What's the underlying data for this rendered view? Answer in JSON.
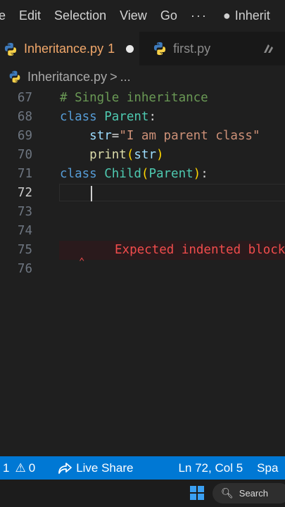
{
  "menubar": {
    "items": [
      "e",
      "Edit",
      "Selection",
      "View",
      "Go",
      "···"
    ],
    "title": "Inherit"
  },
  "tabs": [
    {
      "label": "Inheritance.py",
      "problems": "1",
      "modified": true,
      "active": true
    },
    {
      "label": "first.py",
      "active": false
    }
  ],
  "breadcrumb": {
    "file": "Inheritance.py",
    "sep": ">",
    "rest": "..."
  },
  "editor": {
    "lines": [
      {
        "no": "67",
        "tokens": [
          {
            "t": "# Single inheritance",
            "c": "tok-comment"
          }
        ]
      },
      {
        "no": "68",
        "tokens": [
          {
            "t": "class ",
            "c": "tok-kw"
          },
          {
            "t": "Parent",
            "c": "tok-cls"
          },
          {
            "t": ":",
            "c": "tok-punc"
          }
        ]
      },
      {
        "no": "69",
        "tokens": [
          {
            "t": "    ",
            "c": "tok-punc"
          },
          {
            "t": "str",
            "c": "tok-var"
          },
          {
            "t": "=",
            "c": "tok-punc"
          },
          {
            "t": "\"I am parent class\"",
            "c": "tok-str"
          }
        ]
      },
      {
        "no": "70",
        "tokens": [
          {
            "t": "    ",
            "c": "tok-punc"
          },
          {
            "t": "print",
            "c": "tok-fn"
          },
          {
            "t": "(",
            "c": "tok-paren"
          },
          {
            "t": "str",
            "c": "tok-var"
          },
          {
            "t": ")",
            "c": "tok-paren"
          }
        ]
      },
      {
        "no": "71",
        "tokens": [
          {
            "t": "class ",
            "c": "tok-kw"
          },
          {
            "t": "Child",
            "c": "tok-cls"
          },
          {
            "t": "(",
            "c": "tok-paren"
          },
          {
            "t": "Parent",
            "c": "tok-cls"
          },
          {
            "t": ")",
            "c": "tok-paren"
          },
          {
            "t": ":",
            "c": "tok-punc"
          }
        ]
      },
      {
        "no": "72",
        "tokens": [],
        "current": true
      },
      {
        "no": "73",
        "tokens": []
      },
      {
        "no": "74",
        "tokens": []
      },
      {
        "no": "75",
        "tokens": [],
        "error": "Expected indented block"
      },
      {
        "no": "76",
        "tokens": []
      }
    ]
  },
  "statusbar": {
    "errors": "1",
    "warnings": "0",
    "live_share": "Live Share",
    "position": "Ln 72, Col 5",
    "spaces": "Spa"
  },
  "taskbar": {
    "search": "Search"
  },
  "colors": {
    "accent": "#0078d4",
    "error": "#f14c4c",
    "modified_tab": "#f2a86b"
  }
}
